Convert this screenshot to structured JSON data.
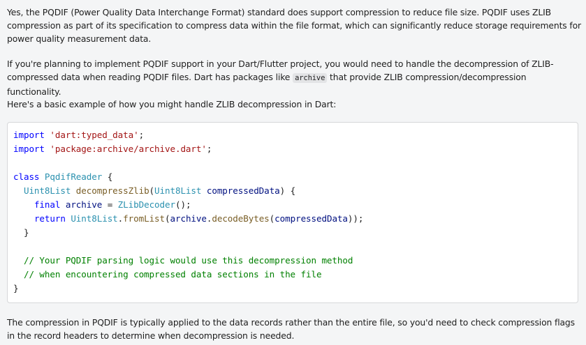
{
  "paragraphs": {
    "intro": "Yes, the PQDIF (Power Quality Data Interchange Format) standard does support compression to reduce file size. PQDIF uses ZLIB compression as part of its specification to compress data within the file format, which can significantly reduce storage requirements for power quality measurement data.",
    "support_before": "If you're planning to implement PQDIF support in your Dart/Flutter project, you would need to handle the decompression of ZLIB-compressed data when reading PQDIF files. Dart has packages like ",
    "support_code": "archive",
    "support_after": " that provide ZLIB compression/decompression functionality.",
    "example_intro": "Here's a basic example of how you might handle ZLIB decompression in Dart:",
    "conclusion": "The compression in PQDIF is typically applied to the data records rather than the entire file, so you'd need to check compression flags in the record headers to determine when decompression is needed."
  },
  "code": {
    "language": "dart",
    "l1_kw": "import",
    "l1_str": "'dart:typed_data'",
    "l1_end": ";",
    "l2_kw": "import",
    "l2_str": "'package:archive/archive.dart'",
    "l2_end": ";",
    "l4_kw": "class",
    "l4_cls": "PqdifReader",
    "l4_end": " {",
    "l5_indent": "  ",
    "l5_type": "Uint8List",
    "l5_fn": "decompressZlib",
    "l5_open": "(",
    "l5_ptype": "Uint8List",
    "l5_param": "compressedData",
    "l5_end": ") {",
    "l6_indent": "    ",
    "l6_kw": "final",
    "l6_var": "archive",
    "l6_eq": " = ",
    "l6_cls": "ZLibDecoder",
    "l6_end": "();",
    "l7_indent": "    ",
    "l7_kw": "return",
    "l7_cls": "Uint8List",
    "l7_dot": ".",
    "l7_fn": "fromList",
    "l7_open": "(",
    "l7_var": "archive",
    "l7_dot2": ".",
    "l7_fn2": "decodeBytes",
    "l7_open2": "(",
    "l7_param": "compressedData",
    "l7_end": "));",
    "l8": "  }",
    "l10_indent": "  ",
    "l10_cm": "// Your PQDIF parsing logic would use this decompression method",
    "l11_indent": "  ",
    "l11_cm": "// when encountering compressed data sections in the file",
    "l12": "}"
  }
}
